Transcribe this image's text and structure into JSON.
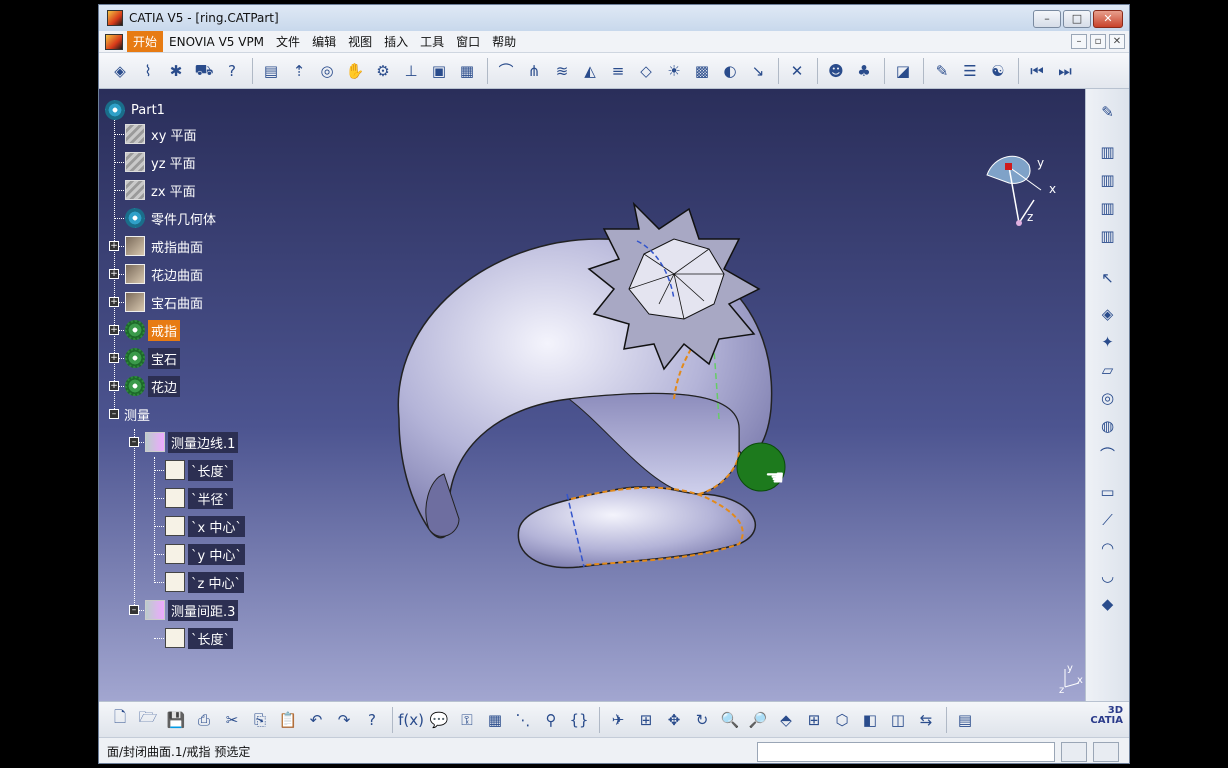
{
  "window": {
    "title": "CATIA V5 - [ring.CATPart]"
  },
  "menubar": {
    "items": [
      "开始",
      "ENOVIA V5 VPM",
      "文件",
      "编辑",
      "视图",
      "插入",
      "工具",
      "窗口",
      "帮助"
    ]
  },
  "tree": {
    "root": "Part1",
    "planes": [
      "xy 平面",
      "yz 平面",
      "zx 平面"
    ],
    "body": "零件几何体",
    "surfaces": [
      "戒指曲面",
      "花边曲面",
      "宝石曲面"
    ],
    "bodies": [
      "戒指",
      "宝石",
      "花边"
    ],
    "measure": "测量",
    "measure_edge": "测量边线.1",
    "edge_params": [
      "`长度`",
      "`半径`",
      "`x 中心`",
      "`y 中心`",
      "`z 中心`"
    ],
    "measure_between": "测量间距.3",
    "between_params": [
      "`长度`"
    ]
  },
  "compass": {
    "x": "x",
    "y": "y",
    "z": "z"
  },
  "status": {
    "text": "面/封闭曲面.1/戒指 预选定"
  },
  "logo": {
    "line1": "3D",
    "line2": "CATIA"
  },
  "colors": {
    "accent": "#e77b13",
    "viewport_top": "#2a2e5a",
    "viewport_bottom": "#a2a6d0"
  }
}
